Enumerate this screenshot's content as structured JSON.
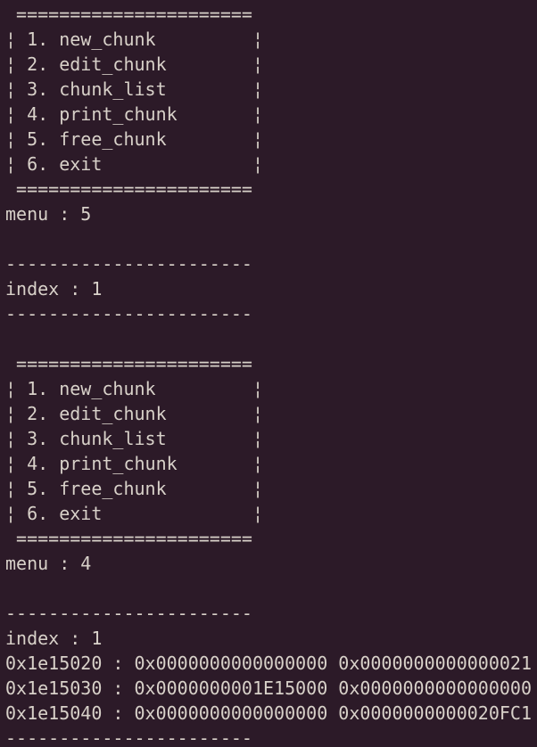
{
  "theme": {
    "background": "#2c1a28",
    "foreground": "#d8d1c9"
  },
  "terminal": {
    "lines": [
      " ======================",
      "¦ 1. new_chunk         ¦",
      "¦ 2. edit_chunk        ¦",
      "¦ 3. chunk_list        ¦",
      "¦ 4. print_chunk       ¦",
      "¦ 5. free_chunk        ¦",
      "¦ 6. exit              ¦",
      " ======================",
      "menu : 5",
      "",
      "-----------------------",
      "index : 1",
      "-----------------------",
      "",
      " ======================",
      "¦ 1. new_chunk         ¦",
      "¦ 2. edit_chunk        ¦",
      "¦ 3. chunk_list        ¦",
      "¦ 4. print_chunk       ¦",
      "¦ 5. free_chunk        ¦",
      "¦ 6. exit              ¦",
      " ======================",
      "menu : 4",
      "",
      "-----------------------",
      "index : 1",
      "0x1e15020 : 0x0000000000000000 0x0000000000000021",
      "0x1e15030 : 0x0000000001E15000 0x0000000000000000",
      "0x1e15040 : 0x0000000000000000 0x0000000000020FC1",
      "-----------------------"
    ]
  }
}
